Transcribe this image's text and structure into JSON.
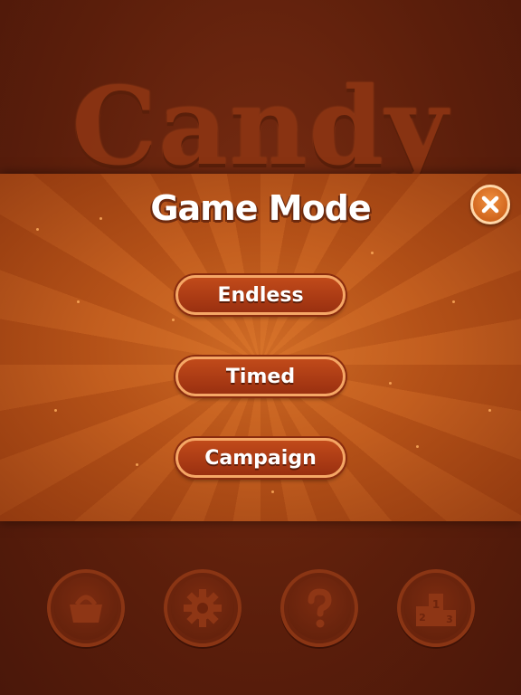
{
  "background": {
    "title": "Candy"
  },
  "dialog": {
    "title": "Game Mode",
    "close_icon": "close-icon",
    "buttons": [
      {
        "label": "Endless"
      },
      {
        "label": "Timed"
      },
      {
        "label": "Campaign"
      }
    ]
  },
  "bottom_nav": [
    {
      "icon": "basket-icon"
    },
    {
      "icon": "gear-icon"
    },
    {
      "icon": "help-icon"
    },
    {
      "icon": "podium-icon"
    }
  ],
  "colors": {
    "background": "#5e1f0c",
    "panel": "#bb5519",
    "button_fill": "#b03c14",
    "button_border": "#f5a766",
    "text": "#ffffff"
  }
}
